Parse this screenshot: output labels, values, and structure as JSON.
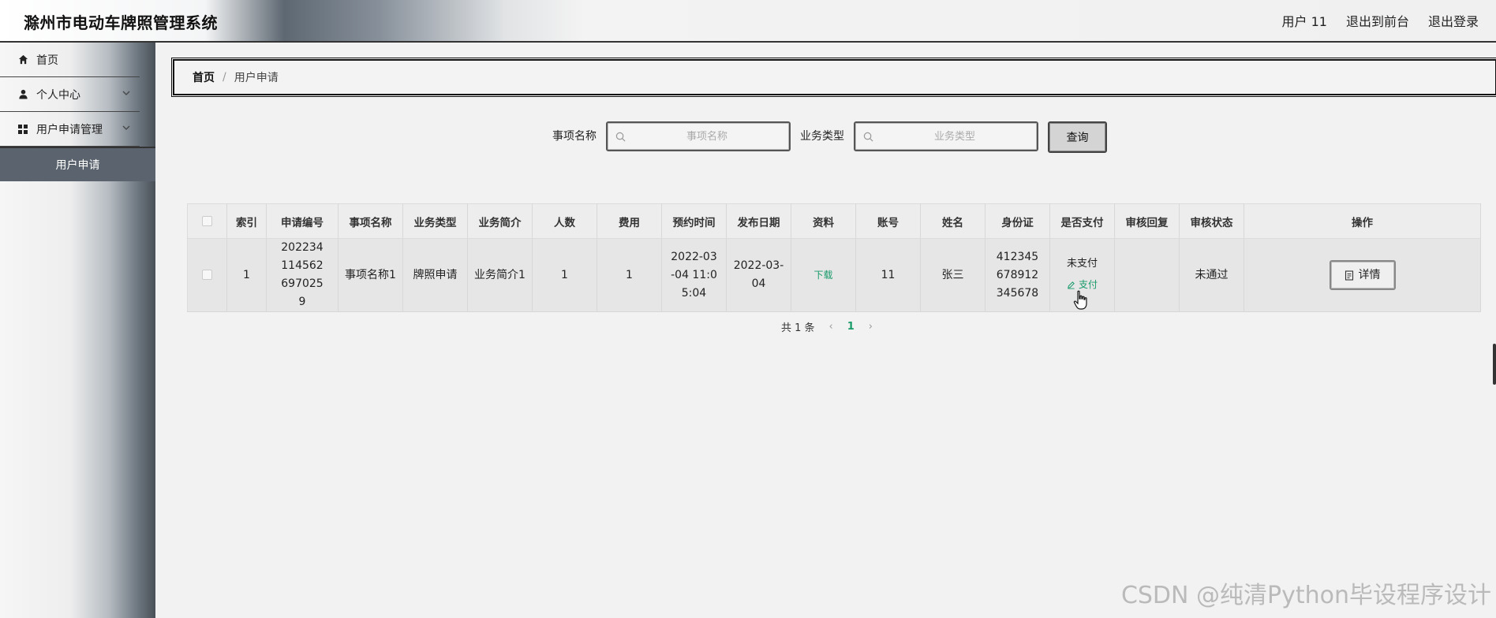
{
  "header": {
    "title": "滁州市电动车牌照管理系统",
    "user": "用户 11",
    "back_to_front": "退出到前台",
    "logout": "退出登录"
  },
  "sidebar": {
    "home": "首页",
    "personal_center": "个人中心",
    "application_mgmt": "用户申请管理",
    "application_sub": "用户申请"
  },
  "breadcrumb": {
    "home": "首页",
    "separator": "/",
    "current": "用户申请"
  },
  "search": {
    "item_label": "事项名称",
    "item_placeholder": "事项名称",
    "type_label": "业务类型",
    "type_placeholder": "业务类型",
    "query_button": "查询"
  },
  "table": {
    "headers": [
      "索引",
      "申请编号",
      "事项名称",
      "业务类型",
      "业务简介",
      "人数",
      "费用",
      "预约时间",
      "发布日期",
      "资料",
      "账号",
      "姓名",
      "身份证",
      "是否支付",
      "审核回复",
      "审核状态",
      "操作"
    ],
    "rows": [
      {
        "index": "1",
        "app_no": "2022341145626970259",
        "item_name": "事项名称1",
        "biz_type": "牌照申请",
        "biz_intro": "业务简介1",
        "people": "1",
        "fee": "1",
        "appointment": "2022-03-04 11:05:04",
        "publish_date": "2022-03-04",
        "material": "下载",
        "account": "11",
        "name": "张三",
        "id_card": "412345678912345678",
        "paid": "未支付",
        "pay_action": "支付",
        "review_reply": "",
        "review_status": "未通过",
        "detail_button": "详情"
      }
    ]
  },
  "pagination": {
    "total": "共 1 条",
    "current_page": "1"
  },
  "watermark": "CSDN @纯清Python毕设程序设计"
}
